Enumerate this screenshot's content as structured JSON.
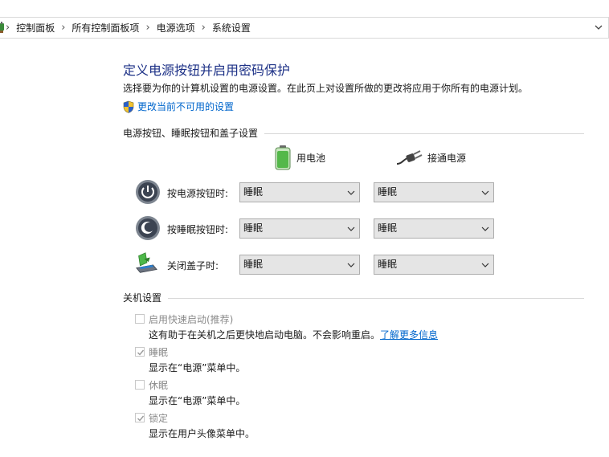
{
  "breadcrumb": {
    "items": [
      "控制面板",
      "所有控制面板项",
      "电源选项",
      "系统设置"
    ]
  },
  "page": {
    "title": "定义电源按钮并启用密码保护",
    "description": "选择要为你的计算机设置的电源设置。在此页上对设置所做的更改将应用于你所有的电源计划。",
    "change_link": "更改当前不可用的设置"
  },
  "power_section": {
    "label": "电源按钮、睡眠按钮和盖子设置",
    "col_battery": "用电池",
    "col_plugged": "接通电源",
    "rows": [
      {
        "label": "按电源按钮时:",
        "battery": "睡眠",
        "plugged": "睡眠"
      },
      {
        "label": "按睡眠按钮时:",
        "battery": "睡眠",
        "plugged": "睡眠"
      },
      {
        "label": "关闭盖子时:",
        "battery": "睡眠",
        "plugged": "睡眠"
      }
    ]
  },
  "shutdown_section": {
    "label": "关机设置",
    "options": [
      {
        "label": "启用快速启动(推荐)",
        "desc": "这有助于在关机之后更快地启动电脑。不会影响重启。",
        "link": "了解更多信息",
        "checked": false
      },
      {
        "label": "睡眠",
        "desc": "显示在“电源”菜单中。",
        "checked": true
      },
      {
        "label": "休眠",
        "desc": "显示在“电源”菜单中。",
        "checked": false
      },
      {
        "label": "锁定",
        "desc": "显示在用户头像菜单中。",
        "checked": true
      }
    ]
  },
  "colors": {
    "title": "#1e3287",
    "link": "#0066cc",
    "disabled_text": "#8a8a8a"
  }
}
